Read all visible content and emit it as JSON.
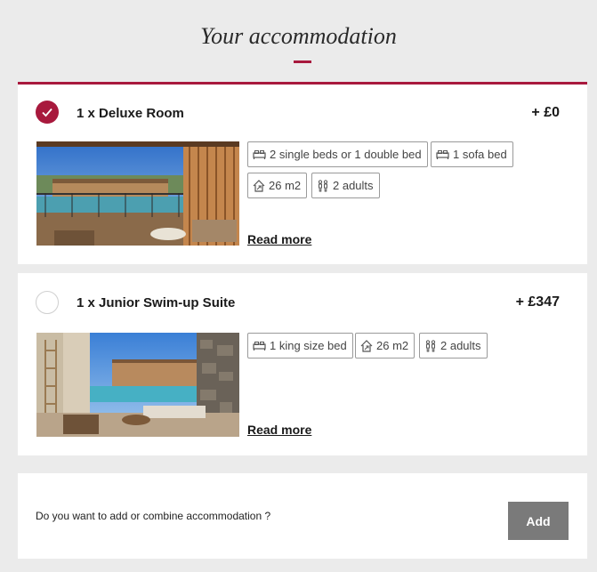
{
  "page": {
    "title": "Your accommodation",
    "accent_color": "#a8193d"
  },
  "rooms": [
    {
      "name": "1 x Deluxe Room",
      "price": "+ £0",
      "selected": true,
      "features": [
        {
          "icon": "bed-icon",
          "text": "2 single beds or 1 double bed"
        },
        {
          "icon": "sofa-bed-icon",
          "text": "1 sofa bed"
        },
        {
          "icon": "area-icon",
          "text": "26 m2"
        },
        {
          "icon": "guests-icon",
          "text": "2 adults"
        }
      ],
      "read_more": "Read more",
      "image": "balcony overlooking pool"
    },
    {
      "name": "1 x Junior Swim-up Suite",
      "price": "+ £347",
      "selected": false,
      "features": [
        {
          "icon": "bed-icon",
          "text": "1 king size bed"
        },
        {
          "icon": "area-icon",
          "text": "26 m2"
        },
        {
          "icon": "guests-icon",
          "text": "2 adults"
        }
      ],
      "read_more": "Read more",
      "image": "terrace with swim-up pool"
    }
  ],
  "add_section": {
    "question": "Do you want to add or combine accommodation ?",
    "button_label": "Add",
    "button_color": "#7a7a7a"
  }
}
